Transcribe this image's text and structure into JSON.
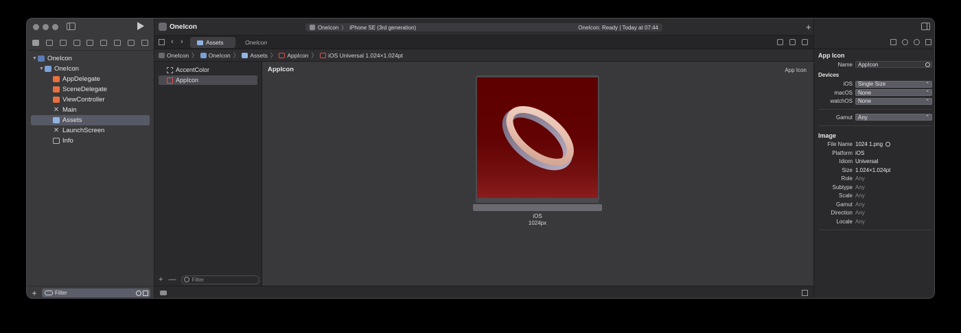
{
  "project": {
    "name": "OneIcon"
  },
  "nav": {
    "items": [
      {
        "label": "OneIcon"
      },
      {
        "label": "OneIcon"
      },
      {
        "label": "AppDelegate"
      },
      {
        "label": "SceneDelegate"
      },
      {
        "label": "ViewController"
      },
      {
        "label": "Main"
      },
      {
        "label": "Assets"
      },
      {
        "label": "LaunchScreen"
      },
      {
        "label": "Info"
      }
    ],
    "filter_placeholder": "Filter"
  },
  "toolbar": {
    "title": "OneIcon",
    "scheme": "OneIcon",
    "device": "iPhone SE (3rd generation)",
    "status": "OneIcon: Ready | Today at 07:44"
  },
  "tabs": [
    {
      "label": "Assets"
    },
    {
      "label": "OneIcon"
    }
  ],
  "breadcrumb": [
    "OneIcon",
    "OneIcon",
    "Assets",
    "AppIcon",
    "iOS Universal 1.024×1.024pt"
  ],
  "asset_list": {
    "items": [
      {
        "label": "AccentColor"
      },
      {
        "label": "AppIcon"
      }
    ],
    "filter_placeholder": "Filter"
  },
  "canvas": {
    "title": "AppIcon",
    "type_label": "App Icon",
    "icon_caption_platform": "iOS",
    "icon_caption_size": "1024px"
  },
  "inspector": {
    "section_app_icon": "App Icon",
    "name_label": "Name",
    "name_value": "AppIcon",
    "devices_header": "Devices",
    "devices": [
      {
        "label": "iOS",
        "value": "Single Size"
      },
      {
        "label": "macOS",
        "value": "None"
      },
      {
        "label": "watchOS",
        "value": "None"
      }
    ],
    "gamut_label": "Gamut",
    "gamut_value": "Any",
    "section_image": "Image",
    "image_props": [
      {
        "label": "File Name",
        "value": "1024 1.png"
      },
      {
        "label": "Platform",
        "value": "iOS"
      },
      {
        "label": "Idiom",
        "value": "Universal"
      },
      {
        "label": "Size",
        "value": "1.024×1.024pt"
      },
      {
        "label": "Role",
        "value": "Any"
      },
      {
        "label": "Subtype",
        "value": "Any"
      },
      {
        "label": "Scale",
        "value": "Any"
      },
      {
        "label": "Gamut",
        "value": "Any"
      },
      {
        "label": "Direction",
        "value": "Any"
      },
      {
        "label": "Locale",
        "value": "Any"
      }
    ]
  },
  "colors": {
    "accent_selected": "#575a66",
    "icon_background": "#620202"
  }
}
